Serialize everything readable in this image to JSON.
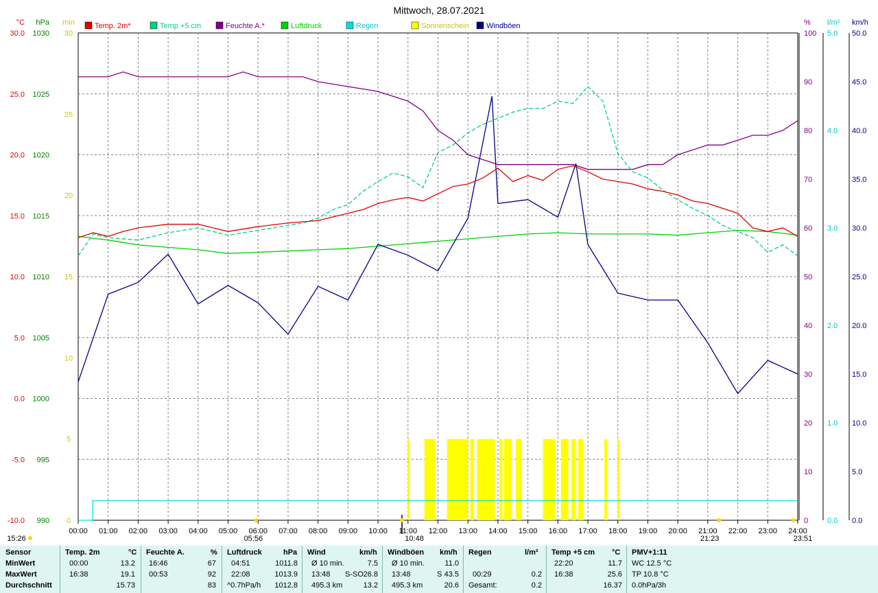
{
  "colors": {
    "temp2m": "#e00000",
    "temp5cm": "#00d080",
    "humidity": "#800080",
    "pressure": "#00d000",
    "rain": "#00e0e0",
    "sunshine": "#ffff00",
    "gusts": "#000080",
    "grid": "#808080",
    "stats_bg": "#dff5f2"
  },
  "chart_data": {
    "type": "line",
    "title": "Mittwoch, 28.07.2021",
    "legend": {
      "placement": "top",
      "entries": [
        {
          "name": "Temp. 2m*",
          "color": "#e00000"
        },
        {
          "name": "Temp +5 cm",
          "color": "#00d080"
        },
        {
          "name": "Feuchte A.*",
          "color": "#800080"
        },
        {
          "name": "Luftdruck",
          "color": "#00d000"
        },
        {
          "name": "Regen",
          "color": "#00e0e0"
        },
        {
          "name": "Sonnenschein",
          "color": "#ffff00"
        },
        {
          "name": "Windböen",
          "color": "#000080"
        }
      ]
    },
    "x_ticks": [
      "00:00",
      "01:00",
      "02:00",
      "03:00",
      "04:00",
      "05:00",
      "06:00",
      "07:00",
      "08:00",
      "09:00",
      "10:00",
      "11:00",
      "12:00",
      "13:00",
      "14:00",
      "15:00",
      "16:00",
      "17:00",
      "18:00",
      "19:00",
      "20:00",
      "21:00",
      "22:00",
      "23:00",
      "24:00"
    ],
    "xlim": [
      0,
      24
    ],
    "axes": {
      "temp": {
        "unit": "°C",
        "range": [
          -10,
          30
        ],
        "ticks": [
          "30.0",
          "25.0",
          "20.0",
          "15.0",
          "10.0",
          "5.0",
          "0.0",
          "-5.0",
          "-10.0"
        ]
      },
      "pressure": {
        "unit": "hPa",
        "range": [
          990,
          1030
        ],
        "ticks": [
          "1030",
          "1025",
          "1020",
          "1015",
          "1010",
          "1005",
          "1000",
          "995",
          "990"
        ]
      },
      "sun_min": {
        "unit": "min",
        "range": [
          0,
          30
        ],
        "ticks": [
          "30",
          "25",
          "20",
          "15",
          "10",
          "5",
          "0"
        ]
      },
      "humidity": {
        "unit": "%",
        "range": [
          0,
          100
        ],
        "ticks": [
          "100",
          "90",
          "80",
          "70",
          "60",
          "50",
          "40",
          "30",
          "20",
          "10",
          "0"
        ]
      },
      "rain": {
        "unit": "l/m²",
        "range": [
          0,
          5
        ],
        "ticks": [
          "5.0",
          "4.0",
          "3.0",
          "2.0",
          "1.0",
          "0.0"
        ]
      },
      "wind": {
        "unit": "km/h",
        "range": [
          0,
          50
        ],
        "ticks": [
          "50.0",
          "45.0",
          "40.0",
          "35.0",
          "30.0",
          "25.0",
          "20.0",
          "15.0",
          "10.0",
          "5.0",
          "0.0"
        ]
      }
    },
    "sun_events": {
      "sunrise": "05:56",
      "sunset": "21:23",
      "noon_marker": "10:48",
      "day_end": "23:51"
    },
    "series": [
      {
        "name": "Temp. 2m*",
        "axis": "temp",
        "x": [
          0,
          0.5,
          1,
          1.5,
          2,
          3,
          4,
          4.5,
          5,
          6,
          7,
          8,
          8.5,
          9,
          9.5,
          10,
          10.5,
          11,
          11.5,
          12,
          12.5,
          13,
          13.5,
          14,
          14.5,
          15,
          15.5,
          16,
          16.5,
          17,
          17.5,
          18,
          18.5,
          19,
          19.5,
          20,
          20.5,
          21,
          21.5,
          22,
          22.5,
          23,
          23.5,
          24
        ],
        "y": [
          13.2,
          13.6,
          13.3,
          13.7,
          14.0,
          14.3,
          14.3,
          14.0,
          13.7,
          14.1,
          14.4,
          14.6,
          14.9,
          15.2,
          15.5,
          16.0,
          16.3,
          16.5,
          16.2,
          16.8,
          17.4,
          17.6,
          18.1,
          18.9,
          17.8,
          18.3,
          17.9,
          18.8,
          19.1,
          18.6,
          18.0,
          17.8,
          17.6,
          17.2,
          17.0,
          16.7,
          16.2,
          16.0,
          15.6,
          15.2,
          14.0,
          13.7,
          14.0,
          13.3
        ]
      },
      {
        "name": "Temp +5 cm",
        "axis": "temp",
        "x": [
          0,
          0.5,
          1,
          2,
          3,
          4,
          5,
          6,
          7,
          7.5,
          8,
          8.5,
          9,
          9.5,
          10,
          10.5,
          11,
          11.5,
          12,
          12.5,
          13,
          13.5,
          14,
          14.5,
          15,
          15.5,
          16,
          16.5,
          17,
          17.5,
          18,
          18.5,
          19,
          19.5,
          20,
          20.5,
          21,
          21.5,
          22,
          22.5,
          23,
          23.5,
          24
        ],
        "y": [
          11.7,
          13.5,
          13.2,
          13.0,
          13.6,
          14.0,
          13.4,
          13.8,
          14.2,
          14.4,
          14.8,
          15.5,
          15.9,
          17.0,
          17.8,
          18.5,
          18.2,
          17.3,
          20.2,
          20.8,
          21.8,
          22.5,
          23.0,
          23.5,
          23.8,
          23.8,
          24.4,
          24.2,
          25.6,
          24.4,
          20.1,
          18.6,
          18.1,
          17.1,
          16.3,
          15.6,
          15.0,
          14.2,
          13.7,
          13.2,
          12.0,
          12.6,
          11.7
        ]
      },
      {
        "name": "Feuchte A.*",
        "axis": "humidity",
        "x": [
          0,
          1,
          1.5,
          2,
          3,
          4,
          4.5,
          5,
          5.5,
          6,
          7,
          7.5,
          8,
          9,
          10,
          10.5,
          11,
          11.5,
          12,
          12.5,
          13,
          13.5,
          14,
          15,
          15.5,
          16,
          16.5,
          17,
          17.5,
          18,
          18.5,
          19,
          19.5,
          20,
          20.5,
          21,
          21.5,
          22,
          22.5,
          23,
          23.5,
          24
        ],
        "y": [
          91,
          91,
          92,
          91,
          91,
          91,
          91,
          91,
          92,
          91,
          91,
          91,
          90,
          89,
          88,
          87,
          86,
          84,
          80,
          78,
          75,
          74,
          73,
          73,
          73,
          73,
          73,
          72,
          72,
          72,
          72,
          73,
          73,
          75,
          76,
          77,
          77,
          78,
          79,
          79,
          80,
          82
        ]
      },
      {
        "name": "Luftdruck",
        "axis": "pressure",
        "x": [
          0,
          1,
          2,
          3,
          4,
          5,
          6,
          7,
          8,
          9,
          10,
          11,
          12,
          13,
          14,
          15,
          16,
          17,
          18,
          19,
          20,
          21,
          22,
          23,
          24
        ],
        "y": [
          1013.3,
          1013.0,
          1012.6,
          1012.4,
          1012.2,
          1011.9,
          1012.0,
          1012.1,
          1012.2,
          1012.3,
          1012.5,
          1012.7,
          1012.9,
          1013.1,
          1013.3,
          1013.5,
          1013.6,
          1013.5,
          1013.5,
          1013.5,
          1013.4,
          1013.6,
          1013.8,
          1013.7,
          1013.4
        ]
      },
      {
        "name": "Regen",
        "axis": "rain",
        "x": [
          0,
          0.48,
          0.49,
          24
        ],
        "y": [
          0,
          0,
          0.2,
          0.2
        ]
      },
      {
        "name": "Windböen",
        "axis": "wind",
        "x": [
          0,
          1,
          2,
          3,
          4,
          5,
          6,
          7,
          8,
          9,
          10,
          11,
          12,
          13,
          13.8,
          14,
          15,
          16,
          16.6,
          17,
          18,
          19,
          20,
          21,
          22,
          23,
          24
        ],
        "y": [
          14.2,
          23.2,
          24.4,
          27.3,
          22.2,
          24.1,
          22.3,
          19.1,
          24.0,
          22.6,
          28.3,
          27.2,
          25.6,
          31.0,
          43.5,
          32.5,
          32.9,
          31.1,
          36.6,
          28.3,
          23.3,
          22.6,
          22.6,
          18.2,
          13.0,
          16.4,
          15.0
        ]
      }
    ],
    "sunshine_intervals": [
      [
        11.0,
        11.05
      ],
      [
        11.55,
        11.9
      ],
      [
        12.3,
        13.0
      ],
      [
        13.08,
        13.2
      ],
      [
        13.3,
        13.9
      ],
      [
        14.05,
        14.15
      ],
      [
        14.2,
        14.45
      ],
      [
        14.6,
        14.8
      ],
      [
        15.5,
        15.9
      ],
      [
        16.1,
        16.35
      ],
      [
        16.45,
        16.6
      ],
      [
        16.68,
        16.85
      ],
      [
        17.55,
        17.65
      ],
      [
        18.0,
        18.05
      ]
    ]
  },
  "stats": {
    "headers": {
      "sensor": "Sensor",
      "temp2m": "Temp. 2m",
      "temp2m_unit": "°C",
      "hum": "Feuchte A.",
      "hum_unit": "%",
      "press": "Luftdruck",
      "press_unit": "hPa",
      "wind": "Wind",
      "wind_unit": "km/h",
      "gust": "Windböen",
      "gust_unit": "km/h",
      "rain": "Regen",
      "rain_unit": "l/m²",
      "temp5": "Temp +5 cm",
      "temp5_unit": "°C",
      "pmv": "PMV+1:11"
    },
    "row_labels": [
      "MinWert",
      "MaxWert",
      "Durchschnitt"
    ],
    "temp2m": [
      [
        "00:00",
        "13.2"
      ],
      [
        "16:38",
        "19.1"
      ],
      [
        "",
        "15.73"
      ]
    ],
    "hum": [
      [
        "16:46",
        "67"
      ],
      [
        "00:53",
        "92"
      ],
      [
        "",
        "83"
      ]
    ],
    "press": [
      [
        "04:51",
        "1011.8"
      ],
      [
        "22:08",
        "1013.9"
      ],
      [
        "^0.7hPa/h",
        "1012.8"
      ]
    ],
    "wind": [
      [
        "Ø 10 min.",
        "",
        "7.5"
      ],
      [
        "13:48",
        "S-SO",
        "26.8"
      ],
      [
        "495.3 km",
        "",
        "13.2"
      ]
    ],
    "gust": [
      [
        "Ø 10 min.",
        "",
        "11.0"
      ],
      [
        "13:48",
        "S",
        "43.5"
      ],
      [
        "495.3 km",
        "",
        "20.6"
      ]
    ],
    "rain": [
      [
        "",
        ""
      ],
      [
        "00:29",
        "0.2"
      ],
      [
        "Gesamt:",
        "0.2"
      ]
    ],
    "temp5": [
      [
        "22:20",
        "11.7"
      ],
      [
        "16:38",
        "25.6"
      ],
      [
        "",
        "16.37"
      ]
    ],
    "pmv": [
      "WC 12.5 °C",
      "TP 10.8 °C",
      "0.0hPa/3h"
    ]
  }
}
